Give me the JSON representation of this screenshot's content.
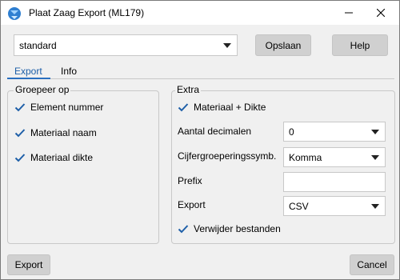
{
  "window": {
    "title": "Plaat Zaag Export (ML179)"
  },
  "top": {
    "profile_value": "standard",
    "save_label": "Opslaan",
    "help_label": "Help"
  },
  "tabs": [
    {
      "label": "Export"
    },
    {
      "label": "Info"
    }
  ],
  "group_by": {
    "title": "Groepeer op",
    "items": [
      {
        "label": "Element nummer",
        "checked": true
      },
      {
        "label": "Materiaal naam",
        "checked": true
      },
      {
        "label": "Materiaal dikte",
        "checked": true
      }
    ]
  },
  "extra": {
    "title": "Extra",
    "material_thickness": {
      "label": "Materiaal + Dikte",
      "checked": true
    },
    "decimals": {
      "label": "Aantal decimalen",
      "value": "0"
    },
    "separator": {
      "label": "Cijfergroeperingssymb.",
      "value": "Komma"
    },
    "prefix": {
      "label": "Prefix",
      "value": ""
    },
    "export": {
      "label": "Export",
      "value": "CSV"
    },
    "delete_files": {
      "label": "Verwijder bestanden",
      "checked": true
    }
  },
  "footer": {
    "export_label": "Export",
    "cancel_label": "Cancel"
  },
  "colors": {
    "accent": "#2a6fc0",
    "check": "#1e5fa8"
  }
}
